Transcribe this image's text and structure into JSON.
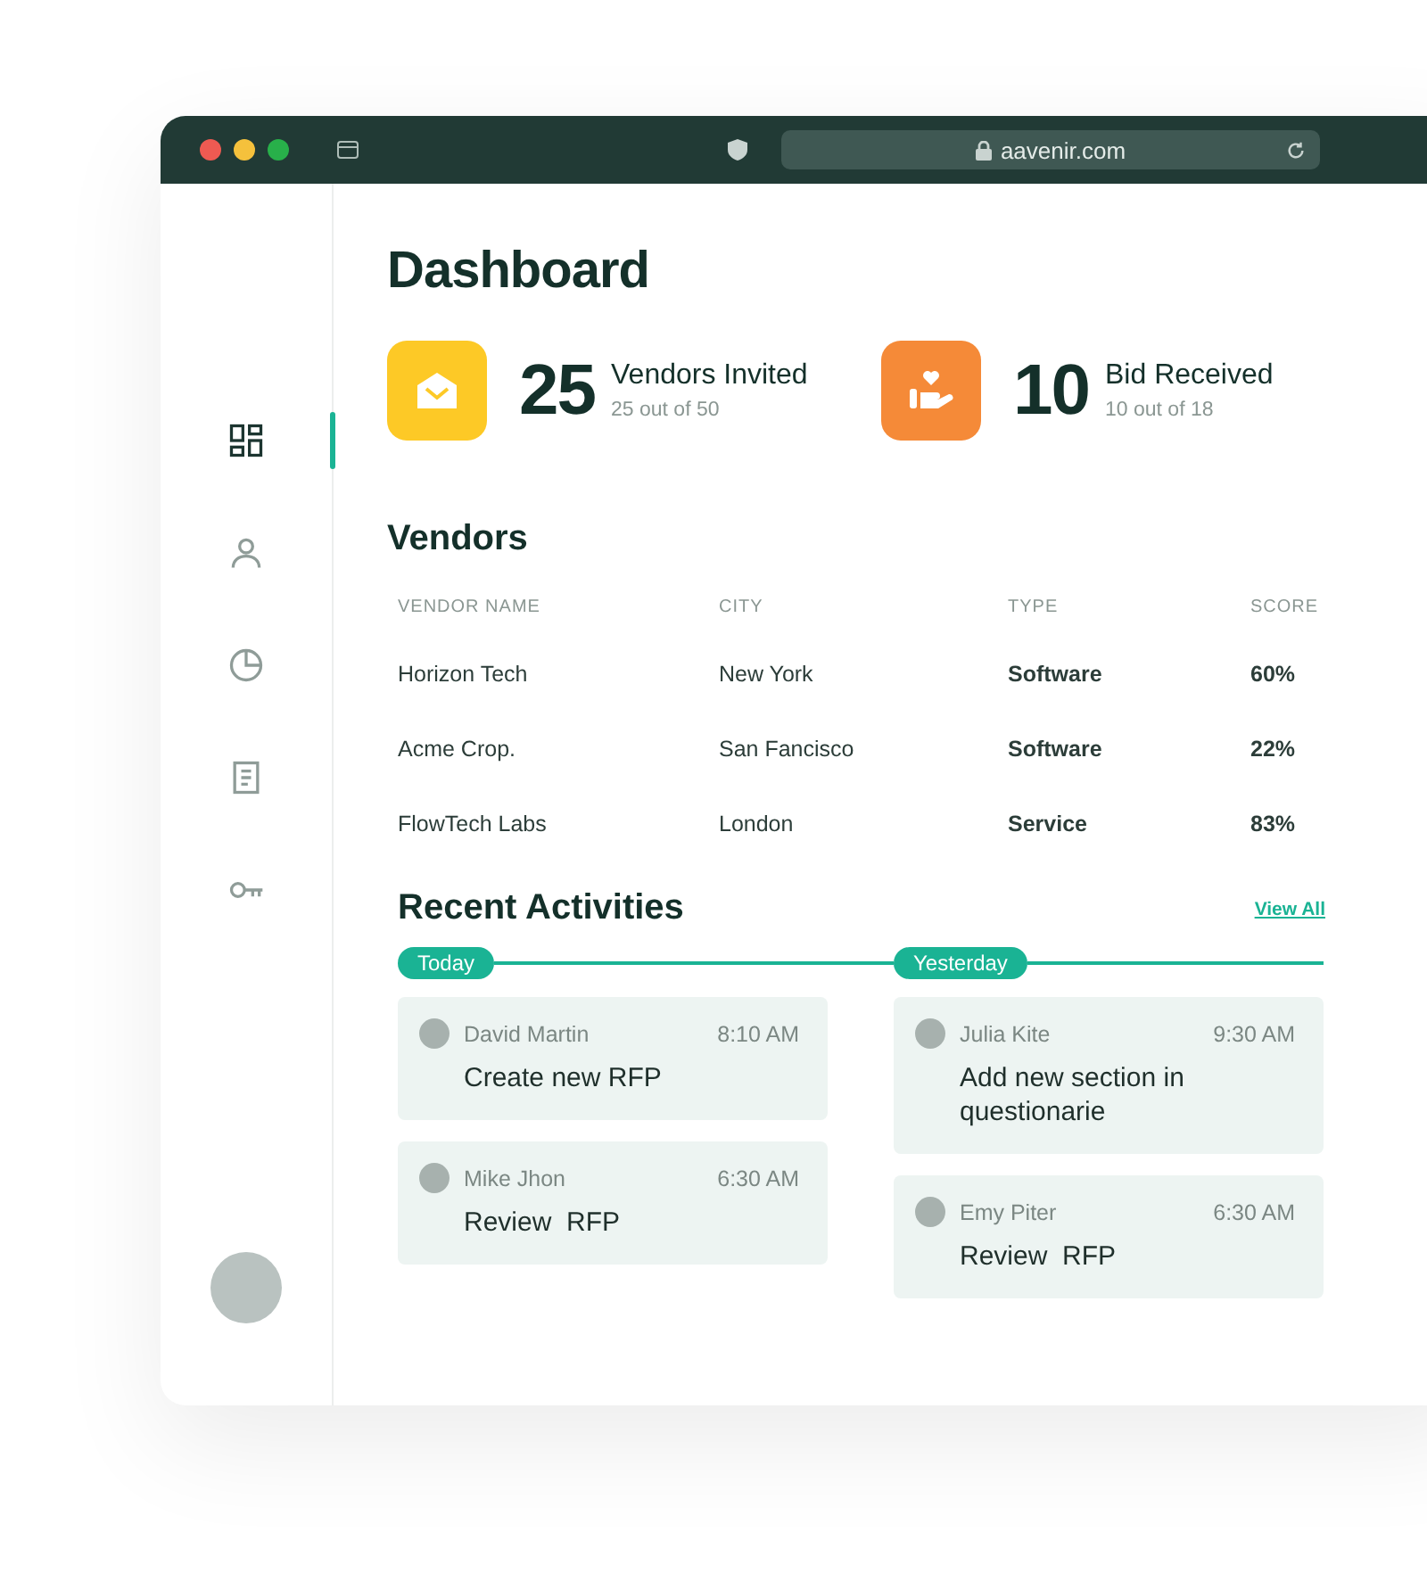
{
  "browser": {
    "url": "aavenir.com"
  },
  "sidebar": {
    "items": [
      {
        "kind": "grid",
        "selected": true
      },
      {
        "kind": "user",
        "selected": false
      },
      {
        "kind": "chart",
        "selected": false
      },
      {
        "kind": "document",
        "selected": false
      },
      {
        "kind": "key",
        "selected": false
      }
    ]
  },
  "title": "Dashboard",
  "stats": [
    {
      "kind": "mail",
      "color": "#fdc926",
      "value": "25",
      "label": "Vendors Invited",
      "detail": "25 out of 50"
    },
    {
      "kind": "gift",
      "color": "#f58a38",
      "value": "10",
      "label": "Bid Received",
      "detail": "10 out of 18"
    }
  ],
  "vendors": {
    "title": "Vendors",
    "columns": [
      "VENDOR NAME",
      "CITY",
      "TYPE",
      "SCORE"
    ],
    "rows": [
      [
        "Horizon Tech",
        "New York",
        "Software",
        "60%"
      ],
      [
        "Acme Crop.",
        "San Fancisco",
        "Software",
        "22%"
      ],
      [
        "FlowTech Labs",
        "London",
        "Service",
        "83%"
      ]
    ]
  },
  "activities": {
    "title": "Recent Activities",
    "link": "View All",
    "groups": [
      {
        "label": "Today",
        "items": [
          {
            "name": "David Martin",
            "time": "8:10 AM",
            "action": "Create new RFP"
          },
          {
            "name": "Mike Jhon",
            "time": "6:30 AM",
            "action": "Review  RFP"
          }
        ]
      },
      {
        "label": "Yesterday",
        "items": [
          {
            "name": "Julia Kite",
            "time": "9:30 AM",
            "action": "Add new section in questionarie"
          },
          {
            "name": "Emy Piter",
            "time": "6:30 AM",
            "action": "Review  RFP"
          }
        ]
      }
    ]
  }
}
